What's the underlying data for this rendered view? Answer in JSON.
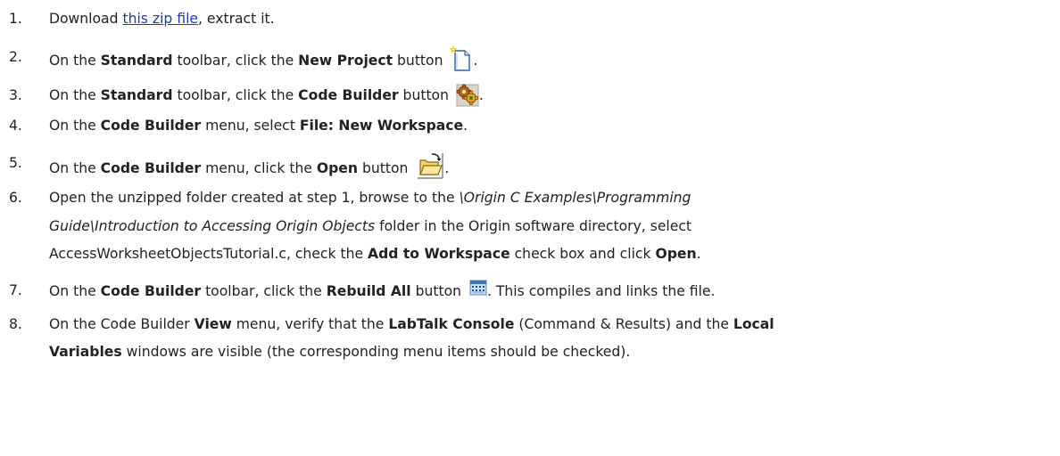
{
  "steps": [
    {
      "num": "1.",
      "pre": "Download ",
      "link": "this zip file",
      "post": ", extract it."
    },
    {
      "num": "2.",
      "pre": "On the ",
      "b1": "Standard",
      "mid": " toolbar, click the ",
      "b2": "New Project",
      "post": " button",
      "end": ".",
      "icon": "new-project-icon"
    },
    {
      "num": "3.",
      "pre": "On the ",
      "b1": "Standard",
      "mid": " toolbar, click the ",
      "b2": "Code Builder",
      "post": " button",
      "end": ".",
      "icon": "code-builder-icon"
    },
    {
      "num": "4.",
      "pre": "On the ",
      "b1": "Code Builder",
      "mid": " menu, select ",
      "b2": "File: New Workspace",
      "end": "."
    },
    {
      "num": "5.",
      "pre": "On the ",
      "b1": "Code Builder",
      "mid": " menu, click the ",
      "b2": "Open",
      "post": " button",
      "end": ".",
      "icon": "open-folder-icon"
    },
    {
      "num": "6.",
      "l1_pre": "Open the unzipped folder created at step 1, browse to the ",
      "l1_it": "\\Origin C Examples\\Programming",
      "l2_it": "Guide\\Introduction to Accessing Origin Objects",
      "l2_post": " folder in the Origin software directory, select",
      "l3_pre": "AccessWorksheetObjectsTutorial.c, check the ",
      "l3_b1": "Add to Workspace",
      "l3_mid": " check box and click ",
      "l3_b2": "Open",
      "l3_end": "."
    },
    {
      "num": "7.",
      "pre": "On the ",
      "b1": "Code Builder",
      "mid": " toolbar, click the ",
      "b2": "Rebuild All",
      "post": " button",
      "end": ". This compiles and links the file.",
      "icon": "rebuild-all-icon"
    },
    {
      "num": "8.",
      "l1_pre": "On the Code Builder ",
      "l1_b1": "View",
      "l1_mid": " menu, verify that the ",
      "l1_b2": "LabTalk Console",
      "l1_mid2": " (Command & Results) and the ",
      "l1_b3": "Local",
      "l2_b": "Variables",
      "l2_post": " windows are visible (the corresponding menu items should be checked)."
    }
  ]
}
